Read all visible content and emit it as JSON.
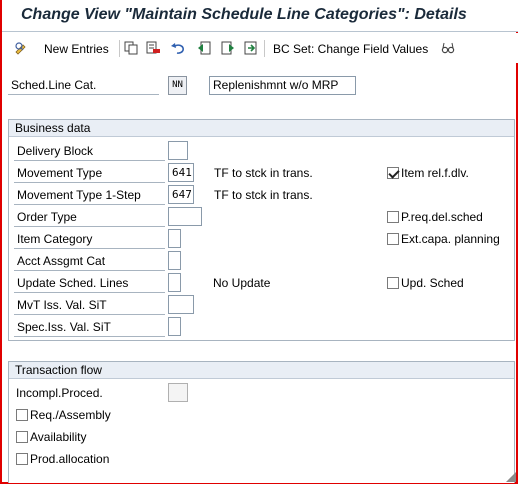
{
  "window": {
    "title": "Change View \"Maintain Schedule Line Categories\": Details"
  },
  "toolbar": {
    "new_entries_label": "New Entries",
    "bc_set_label": "BC Set: Change Field Values",
    "icons": [
      "display-change-icon",
      "copy-icon",
      "delete-icon",
      "undo-icon",
      "previous-entry-icon",
      "next-entry-icon",
      "select-all-icon",
      "glasses-icon"
    ]
  },
  "header": {
    "sched_line_cat_label": "Sched.Line Cat.",
    "sched_line_cat_value": "NN",
    "sched_line_cat_desc": "Replenishmnt w/o MRP"
  },
  "business_data": {
    "title": "Business data",
    "delivery_block_label": "Delivery Block",
    "delivery_block_value": "",
    "movement_type_label": "Movement Type",
    "movement_type_value": "641",
    "movement_type_text": "TF to stck in trans.",
    "movement_type_1step_label": "Movement Type 1-Step",
    "movement_type_1step_value": "647",
    "movement_type_1step_text": "TF to stck in trans.",
    "order_type_label": "Order Type",
    "order_type_value": "",
    "item_category_label": "Item Category",
    "item_category_value": "",
    "acct_assgmt_cat_label": "Acct Assgmt Cat",
    "acct_assgmt_cat_value": "",
    "update_sched_lines_label": "Update Sched. Lines",
    "update_sched_lines_value": "",
    "update_sched_lines_text": "No Update",
    "mvt_iss_val_sit_label": "MvT Iss. Val. SiT",
    "mvt_iss_val_sit_value": "",
    "spec_iss_val_sit_label": "Spec.Iss. Val. SiT",
    "spec_iss_val_sit_value": "",
    "checkboxes": {
      "item_rel_f_dlv": {
        "label": "Item rel.f.dlv.",
        "checked": true
      },
      "p_req_del_sched": {
        "label": "P.req.del.sched",
        "checked": false
      },
      "ext_capa_planning": {
        "label": "Ext.capa. planning",
        "checked": false
      },
      "upd_sched": {
        "label": "Upd. Sched",
        "checked": false
      }
    }
  },
  "transaction_flow": {
    "title": "Transaction flow",
    "incompl_proced_label": "Incompl.Proced.",
    "incompl_proced_value": "",
    "checkboxes": {
      "req_assembly": {
        "label": "Req./Assembly",
        "checked": false
      },
      "availability": {
        "label": "Availability",
        "checked": false
      },
      "prod_allocation": {
        "label": "Prod.allocation",
        "checked": false
      }
    }
  },
  "colors": {
    "frame_border": "#e00000",
    "group_header_bg": "#e9eef5",
    "title_color": "#1a2a3a"
  }
}
